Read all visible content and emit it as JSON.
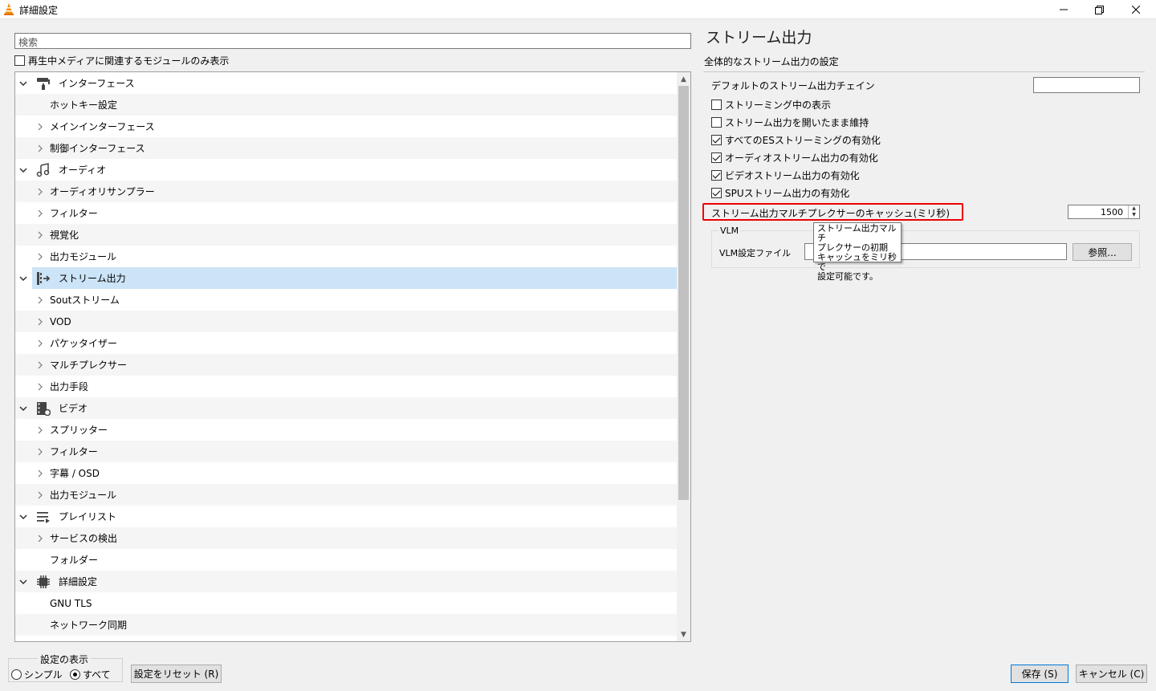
{
  "window": {
    "title": "詳細設定"
  },
  "left": {
    "search_placeholder": "検索",
    "only_current_label": "再生中メディアに関連するモジュールのみ表示",
    "tree": [
      {
        "label": "インターフェース",
        "level": 0,
        "expanded": true,
        "icon": "paint-roller-icon"
      },
      {
        "label": "ホットキー設定",
        "level": 1,
        "has_children": false
      },
      {
        "label": "メインインターフェース",
        "level": 1,
        "has_children": true
      },
      {
        "label": "制御インターフェース",
        "level": 1,
        "has_children": true
      },
      {
        "label": "オーディオ",
        "level": 0,
        "expanded": true,
        "icon": "music-note-icon"
      },
      {
        "label": "オーディオリサンプラー",
        "level": 1,
        "has_children": true
      },
      {
        "label": "フィルター",
        "level": 1,
        "has_children": true
      },
      {
        "label": "視覚化",
        "level": 1,
        "has_children": true
      },
      {
        "label": "出力モジュール",
        "level": 1,
        "has_children": true
      },
      {
        "label": "ストリーム出力",
        "level": 0,
        "expanded": true,
        "icon": "stream-output-icon",
        "selected": true
      },
      {
        "label": "Soutストリーム",
        "level": 1,
        "has_children": true
      },
      {
        "label": "VOD",
        "level": 1,
        "has_children": true
      },
      {
        "label": "パケッタイザー",
        "level": 1,
        "has_children": true
      },
      {
        "label": "マルチプレクサー",
        "level": 1,
        "has_children": true
      },
      {
        "label": "出力手段",
        "level": 1,
        "has_children": true
      },
      {
        "label": "ビデオ",
        "level": 0,
        "expanded": true,
        "icon": "video-film-icon"
      },
      {
        "label": "スプリッター",
        "level": 1,
        "has_children": true
      },
      {
        "label": "フィルター",
        "level": 1,
        "has_children": true
      },
      {
        "label": "字幕 / OSD",
        "level": 1,
        "has_children": true
      },
      {
        "label": "出力モジュール",
        "level": 1,
        "has_children": true
      },
      {
        "label": "プレイリスト",
        "level": 0,
        "expanded": true,
        "icon": "playlist-icon"
      },
      {
        "label": "サービスの検出",
        "level": 1,
        "has_children": true
      },
      {
        "label": "フォルダー",
        "level": 1,
        "has_children": false
      },
      {
        "label": "詳細設定",
        "level": 0,
        "expanded": true,
        "icon": "chip-icon"
      },
      {
        "label": "GNU TLS",
        "level": 1,
        "has_children": false
      },
      {
        "label": "ネットワーク同期",
        "level": 1,
        "has_children": false
      }
    ]
  },
  "bottom": {
    "view_group_label": "設定の表示",
    "simple_label": "シンプル",
    "all_label": "すべて",
    "reset_label": "設定をリセット (R)",
    "save_label": "保存 (S)",
    "cancel_label": "キャンセル (C)"
  },
  "right": {
    "title": "ストリーム出力",
    "subtitle": "全体的なストリーム出力の設定",
    "default_chain_label": "デフォルトのストリーム出力チェイン",
    "default_chain_value": "",
    "options": [
      {
        "label": "ストリーミング中の表示",
        "checked": false
      },
      {
        "label": "ストリーム出力を開いたまま維持",
        "checked": false
      },
      {
        "label": "すべてのESストリーミングの有効化",
        "checked": true
      },
      {
        "label": "オーディオストリーム出力の有効化",
        "checked": true
      },
      {
        "label": "ビデオストリーム出力の有効化",
        "checked": true
      },
      {
        "label": "SPUストリーム出力の有効化",
        "checked": true
      }
    ],
    "cache_label": "ストリーム出力マルチプレクサーのキャッシュ(ミリ秒)",
    "cache_value": "1500",
    "vlm_group": "VLM",
    "vlm_file_label": "VLM設定ファイル",
    "vlm_file_value": "",
    "browse_label": "参照...",
    "tooltip_lines": [
      "ストリーム出力マルチ",
      "プレクサーの初期",
      "キャッシュをミリ秒で",
      "設定可能です。"
    ]
  },
  "colors": {
    "selection": "#cce4f7",
    "highlight": "#e00000",
    "primary_border": "#0078d7"
  }
}
